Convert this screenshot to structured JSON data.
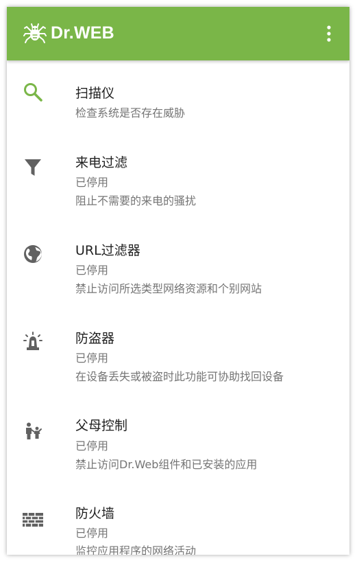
{
  "appbar": {
    "brand": "Dr.WEB",
    "menu_icon": "more-vert-icon",
    "color": "#7ab648"
  },
  "items": [
    {
      "icon": "search-icon",
      "icon_color": "#7ab648",
      "title": "扫描仪",
      "lines": [
        "检查系统是否存在威胁"
      ]
    },
    {
      "icon": "filter-icon",
      "icon_color": "#616161",
      "title": "来电过滤",
      "lines": [
        "已停用",
        "阻止不需要的来电的骚扰"
      ]
    },
    {
      "icon": "globe-icon",
      "icon_color": "#616161",
      "title": "URL过滤器",
      "lines": [
        "已停用",
        "禁止访问所选类型网络资源和个别网站"
      ]
    },
    {
      "icon": "siren-icon",
      "icon_color": "#616161",
      "title": "防盗器",
      "lines": [
        "已停用",
        "在设备丢失或被盗时此功能可协助找回设备"
      ]
    },
    {
      "icon": "parent-child-icon",
      "icon_color": "#616161",
      "title": "父母控制",
      "lines": [
        "已停用",
        "禁止访问Dr.Web组件和已安装的应用"
      ]
    },
    {
      "icon": "firewall-icon",
      "icon_color": "#616161",
      "title": "防火墙",
      "lines": [
        "已停用",
        "监控应用程序的网络活动"
      ]
    }
  ]
}
